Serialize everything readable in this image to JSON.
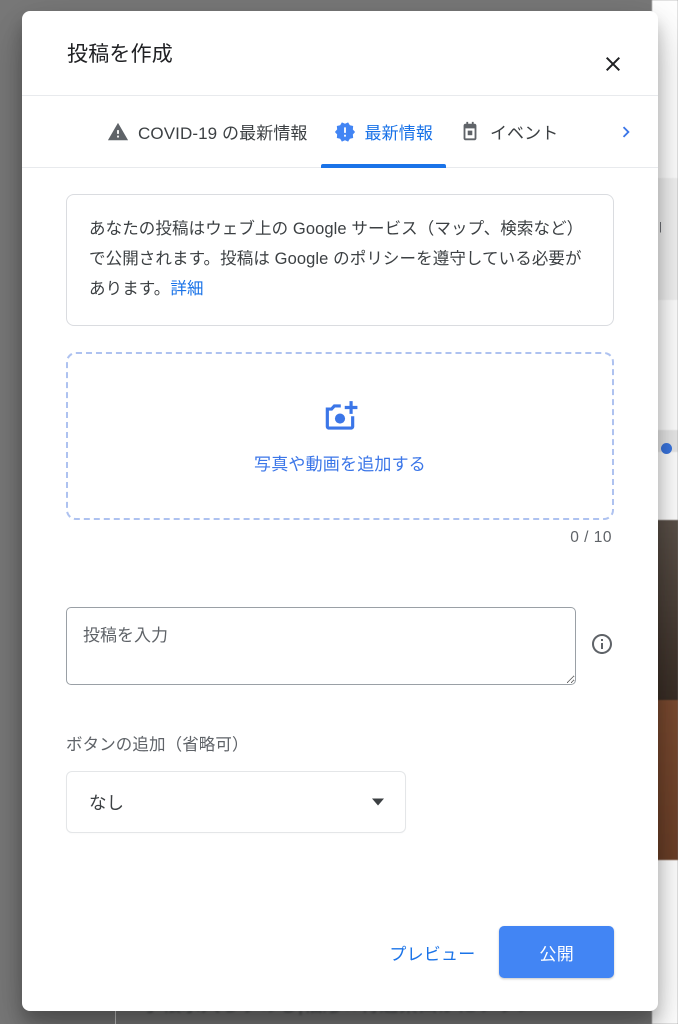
{
  "dialog": {
    "title": "投稿を作成",
    "close_icon": "close-icon"
  },
  "tabs": [
    {
      "label": "COVID-19 の最新情報",
      "icon": "warning-triangle-icon",
      "active": false
    },
    {
      "label": "最新情報",
      "icon": "update-badge-icon",
      "active": true
    },
    {
      "label": "イベント",
      "icon": "calendar-icon",
      "active": false
    }
  ],
  "tab_scroll_next_icon": "chevron-right-icon",
  "notice": {
    "text_before_link": "あなたの投稿はウェブ上の Google サービス（マップ、検索など）で公開されます。投稿は Google のポリシーを遵守している必要があります。",
    "link_label": "詳細"
  },
  "dropzone": {
    "label": "写真や動画を追加する",
    "icon": "add-a-photo-icon",
    "counter": "0 / 10"
  },
  "post": {
    "placeholder": "投稿を入力",
    "value": "",
    "info_icon": "info-circle-icon"
  },
  "button_section": {
    "label": "ボタンの追加（省略可）",
    "selected_option": "なし",
    "caret_icon": "dropdown-caret-icon"
  },
  "footer": {
    "preview_label": "プレビュー",
    "publish_label": "公開"
  },
  "colors": {
    "accent_blue": "#1a73e8",
    "publish_blue": "#4285f4",
    "dropzone_border": "#aec2f0",
    "text_primary": "#202124",
    "text_secondary": "#5f6368"
  },
  "background": {
    "bottom_text": "手帳水入らすのし|福彫☆特選紫山かにフラン"
  }
}
